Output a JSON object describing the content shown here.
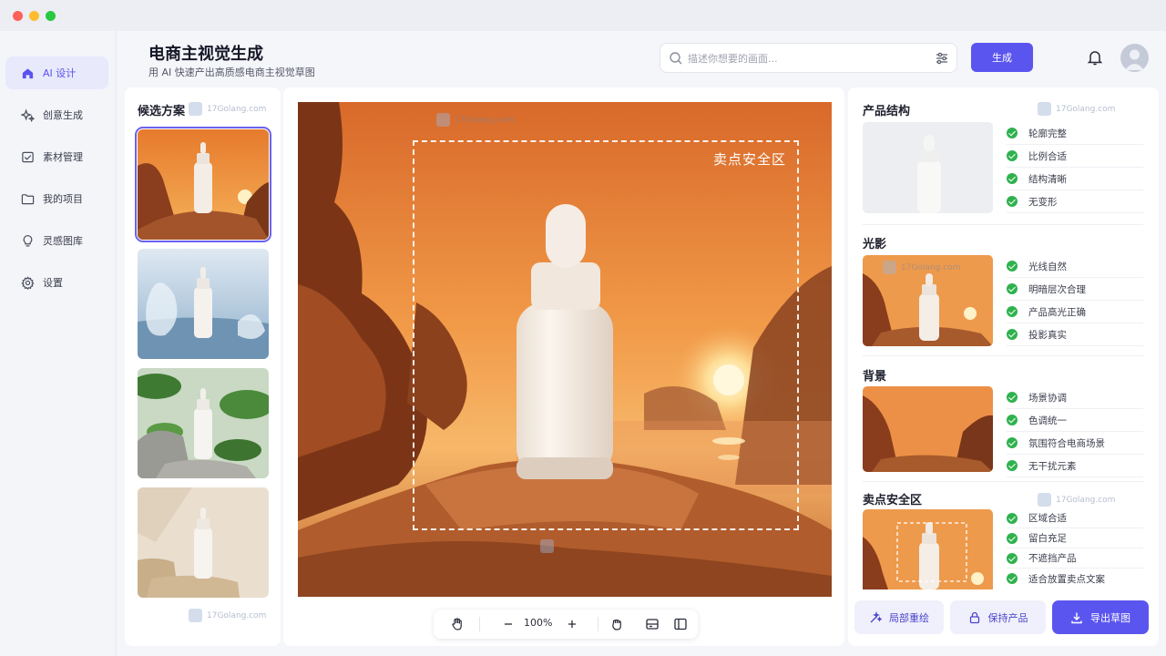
{
  "window": {
    "controls": [
      "close",
      "minimize",
      "maximize"
    ]
  },
  "sidebar": {
    "items": [
      {
        "label": "AI 设计",
        "icon": "home-icon",
        "active": true
      },
      {
        "label": "创意生成",
        "icon": "sparkle-icon",
        "active": false
      },
      {
        "label": "素材管理",
        "icon": "image-folder-icon",
        "active": false
      },
      {
        "label": "我的项目",
        "icon": "folder-icon",
        "active": false
      },
      {
        "label": "灵感图库",
        "icon": "lightbulb-icon",
        "active": false
      },
      {
        "label": "设置",
        "icon": "gear-icon",
        "active": false
      }
    ]
  },
  "header": {
    "title": "电商主视觉生成",
    "subtitle": "用 AI 快速产出高质感电商主视觉草图",
    "search_placeholder": "描述你想要的画面...",
    "generate_label": "生成"
  },
  "candidates": {
    "title": "候选方案",
    "thumbnails": [
      {
        "scene": "sunset-rocks",
        "selected": true
      },
      {
        "scene": "water-splash",
        "selected": false
      },
      {
        "scene": "green-leaves",
        "selected": false
      },
      {
        "scene": "beige-stone",
        "selected": false
      }
    ]
  },
  "canvas": {
    "safe_zone_label": "卖点安全区",
    "zoom": "100%",
    "tools": [
      "hand-icon",
      "zoom-out-icon",
      "zoom-in-icon",
      "grab-icon",
      "compare-icon",
      "panel-icon"
    ]
  },
  "watermark": "17Golang.com",
  "checks": {
    "sections": [
      {
        "title": "产品结构",
        "items": [
          "轮廓完整",
          "比例合适",
          "结构清晰",
          "无变形"
        ]
      },
      {
        "title": "光影",
        "items": [
          "光线自然",
          "明暗层次合理",
          "产品高光正确",
          "投影真实"
        ]
      },
      {
        "title": "背景",
        "items": [
          "场景协调",
          "色调统一",
          "氛围符合电商场景",
          "无干扰元素"
        ]
      },
      {
        "title": "卖点安全区",
        "items": [
          "区域合适",
          "留白充足",
          "不遮挡产品",
          "适合放置卖点文案"
        ]
      }
    ]
  },
  "actions": {
    "partial_redraw": "局部重绘",
    "keep_product": "保持产品",
    "export": "导出草图"
  },
  "colors": {
    "accent": "#5b55ef",
    "check_green": "#2fb24e",
    "active_nav_bg": "#e8e9fb"
  }
}
